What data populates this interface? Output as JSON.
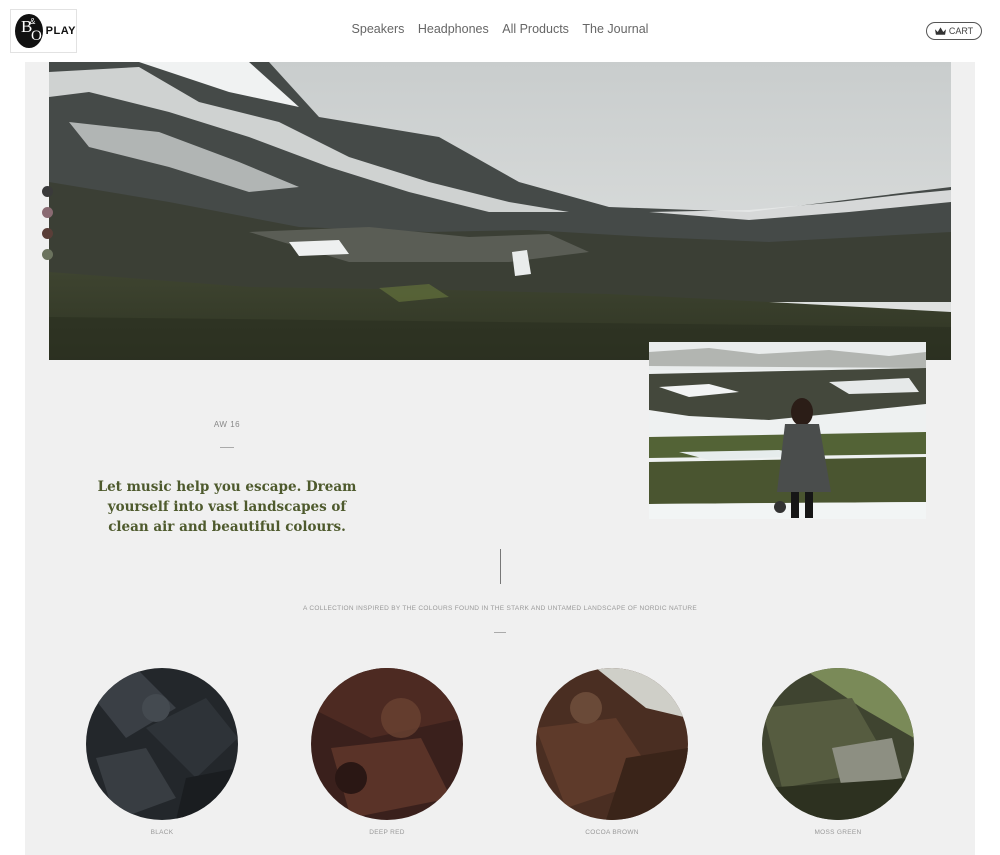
{
  "logo": {
    "wordmark": "PLAY",
    "badge_b": "B",
    "badge_o": "O",
    "badge_amp": "&"
  },
  "nav": {
    "items": [
      "Speakers",
      "Headphones",
      "All Products",
      "The Journal"
    ]
  },
  "cart": {
    "label": "CART",
    "icon": "crown-icon"
  },
  "hero": {
    "swatch_colors": [
      "#3a3a3a",
      "#8a6a72",
      "#5a3e38",
      "#6b735e"
    ]
  },
  "intro": {
    "season": "AW 16",
    "headline": "Let music help you escape. Dream yourself into vast landscapes of clean air and beautiful colours."
  },
  "collection": {
    "tagline": "A COLLECTION INSPIRED BY THE COLOURS FOUND IN THE STARK AND UNTAMED LANDSCAPE OF NORDIC NATURE",
    "colours": [
      {
        "name": "BLACK",
        "hex": "#2b2f33"
      },
      {
        "name": "DEEP RED",
        "hex": "#4a2a25"
      },
      {
        "name": "COCOA BROWN",
        "hex": "#4d3326"
      },
      {
        "name": "MOSS GREEN",
        "hex": "#4c5236"
      }
    ]
  }
}
